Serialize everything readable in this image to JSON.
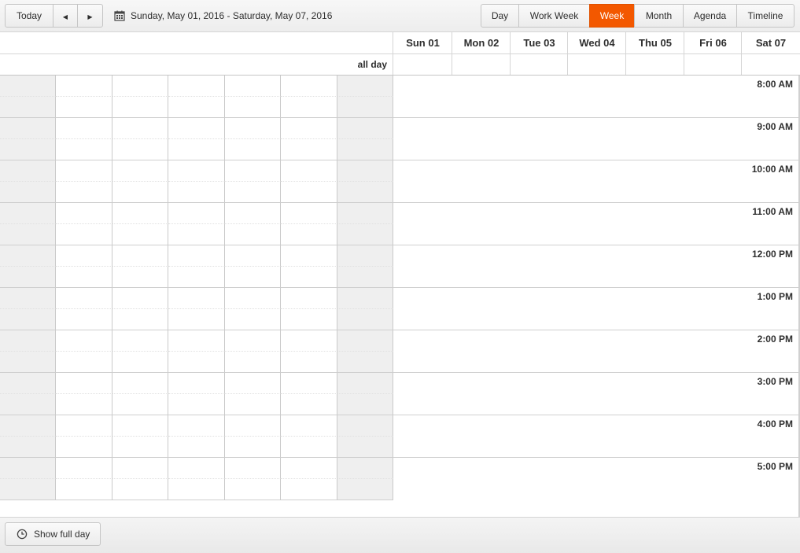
{
  "toolbar": {
    "today_label": "Today",
    "prev_icon": "triangle-left-icon",
    "next_icon": "triangle-right-icon",
    "calendar_icon": "calendar-icon",
    "date_range": "Sunday, May 01, 2016 - Saturday, May 07, 2016",
    "views": [
      {
        "label": "Day",
        "active": false
      },
      {
        "label": "Work Week",
        "active": false
      },
      {
        "label": "Week",
        "active": true
      },
      {
        "label": "Month",
        "active": false
      },
      {
        "label": "Agenda",
        "active": false
      },
      {
        "label": "Timeline",
        "active": false
      }
    ]
  },
  "days": [
    "Sun 01",
    "Mon 02",
    "Tue 03",
    "Wed 04",
    "Thu 05",
    "Fri 06",
    "Sat 07"
  ],
  "all_day_label": "all day",
  "times": [
    "8:00 AM",
    "9:00 AM",
    "10:00 AM",
    "11:00 AM",
    "12:00 PM",
    "1:00 PM",
    "2:00 PM",
    "3:00 PM",
    "4:00 PM",
    "5:00 PM"
  ],
  "footer": {
    "show_full_day_label": "Show full day",
    "clock_icon": "clock-icon"
  },
  "colors": {
    "accent": "#f35800",
    "weekend_cell": "#efefef",
    "border": "#c5c5c5"
  }
}
